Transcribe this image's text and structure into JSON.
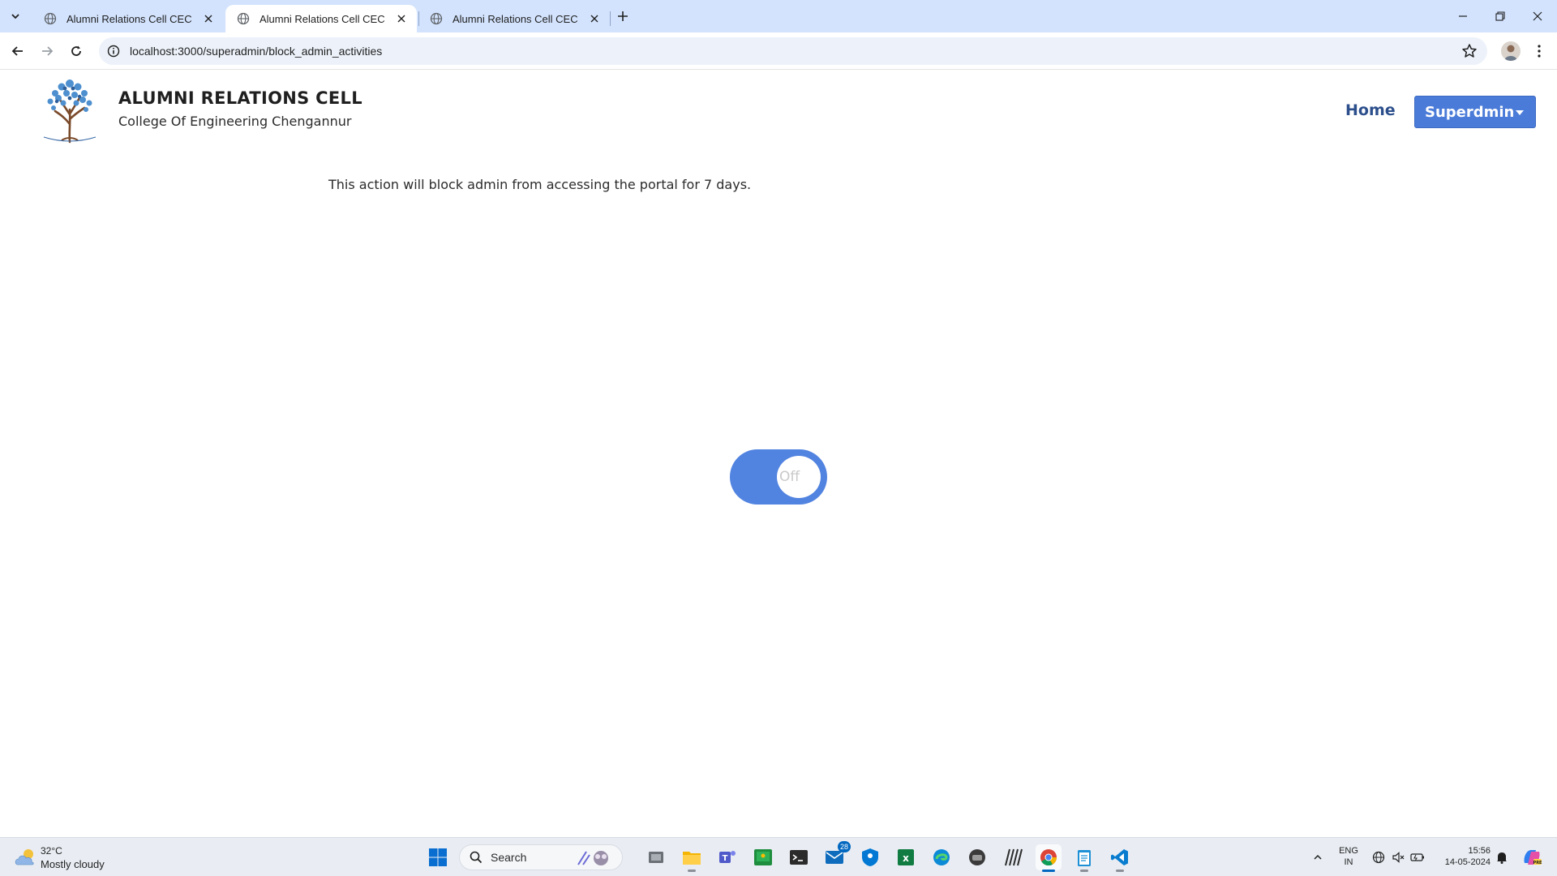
{
  "browser": {
    "tabs": [
      {
        "title": "Alumni Relations Cell CEC",
        "active": false
      },
      {
        "title": "Alumni Relations Cell CEC",
        "active": true
      },
      {
        "title": "Alumni Relations Cell CEC",
        "active": false
      }
    ],
    "url": "localhost:3000/superadmin/block_admin_activities"
  },
  "header": {
    "title": "ALUMNI RELATIONS CELL",
    "subtitle": "College Of Engineering Chengannur",
    "nav": {
      "home": "Home",
      "user_menu": "Superdmin"
    }
  },
  "main": {
    "notice": "This action will block admin from accessing the portal for 7 days.",
    "toggle": {
      "label": "Off",
      "color": "#5183e0"
    }
  },
  "taskbar": {
    "weather": {
      "temp": "32°C",
      "desc": "Mostly cloudy"
    },
    "search_label": "Search",
    "mail_badge": "28",
    "tray": {
      "lang_top": "ENG",
      "lang_bottom": "IN",
      "time": "15:56",
      "date": "14-05-2024"
    }
  }
}
